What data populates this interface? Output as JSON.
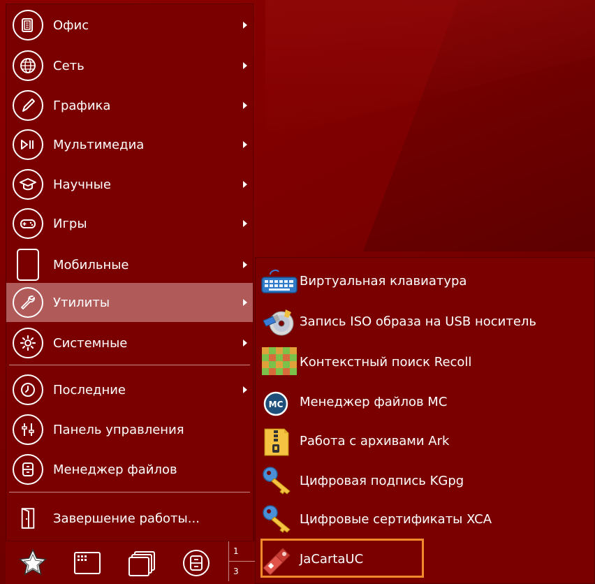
{
  "main_menu": {
    "items": [
      {
        "label": "Офис",
        "icon": "office-icon",
        "submenu": true
      },
      {
        "label": "Сеть",
        "icon": "globe-icon",
        "submenu": true
      },
      {
        "label": "Графика",
        "icon": "pencil-icon",
        "submenu": true
      },
      {
        "label": "Мультимедиа",
        "icon": "play-pause-icon",
        "submenu": true
      },
      {
        "label": "Научные",
        "icon": "graduation-cap-icon",
        "submenu": true
      },
      {
        "label": "Игры",
        "icon": "gamepad-icon",
        "submenu": true
      },
      {
        "label": "Мобильные",
        "icon": "tablet-icon",
        "submenu": true
      },
      {
        "label": "Утилиты",
        "icon": "wrench-icon",
        "submenu": true,
        "active": true
      },
      {
        "label": "Системные",
        "icon": "gear-icon",
        "submenu": true
      }
    ],
    "bottom_items": [
      {
        "label": "Последние",
        "icon": "clock-icon",
        "submenu": true
      },
      {
        "label": "Панель управления",
        "icon": "sliders-icon",
        "submenu": false
      },
      {
        "label": "Менеджер файлов",
        "icon": "drawer-icon",
        "submenu": false
      }
    ],
    "shutdown": {
      "label": "Завершение работы...",
      "icon": "door-icon"
    }
  },
  "submenu_utilities": {
    "items": [
      {
        "label": "Виртуальная клавиатура",
        "icon": "keyboard-icon"
      },
      {
        "label": "Запись ISO образа на USB носитель",
        "icon": "disc-usb-icon"
      },
      {
        "label": "Контекстный поиск Recoll",
        "icon": "recoll-icon"
      },
      {
        "label": "Менеджер файлов MC",
        "icon": "mc-icon",
        "icon_text": "MC"
      },
      {
        "label": "Работа с архивами Ark",
        "icon": "archive-icon"
      },
      {
        "label": "Цифровая подпись KGpg",
        "icon": "key-icon"
      },
      {
        "label": "Цифровые сертификаты XCA",
        "icon": "key-icon"
      },
      {
        "label": "JaCartaUC",
        "icon": "jacarta-icon",
        "highlighted": true
      }
    ]
  },
  "pager": {
    "pages": [
      "1",
      "3"
    ]
  },
  "colors": {
    "accent_highlight": "#f08a2a",
    "menu_bg": "#7a0000",
    "active_item": "#b05a5a"
  }
}
